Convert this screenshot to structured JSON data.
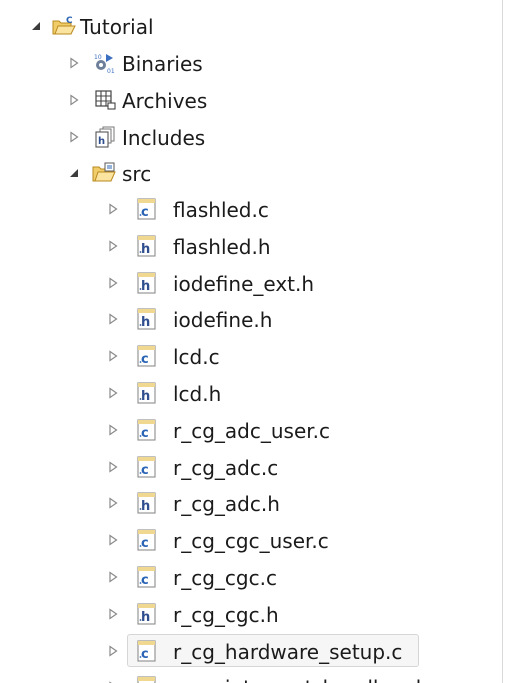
{
  "tree": {
    "project": {
      "label": "Tutorial",
      "expanded": true,
      "icon": "c-project-folder-icon"
    },
    "binaries": {
      "label": "Binaries",
      "icon": "binaries-icon"
    },
    "archives": {
      "label": "Archives",
      "icon": "archives-icon"
    },
    "includes": {
      "label": "Includes",
      "icon": "includes-icon"
    },
    "src": {
      "label": "src",
      "expanded": true,
      "icon": "source-folder-icon"
    },
    "files": [
      {
        "label": "flashled.c",
        "type": "c"
      },
      {
        "label": "flashled.h",
        "type": "h"
      },
      {
        "label": "iodefine_ext.h",
        "type": "h"
      },
      {
        "label": "iodefine.h",
        "type": "h"
      },
      {
        "label": "lcd.c",
        "type": "c"
      },
      {
        "label": "lcd.h",
        "type": "h"
      },
      {
        "label": "r_cg_adc_user.c",
        "type": "c"
      },
      {
        "label": "r_cg_adc.c",
        "type": "c"
      },
      {
        "label": "r_cg_adc.h",
        "type": "h"
      },
      {
        "label": "r_cg_cgc_user.c",
        "type": "c"
      },
      {
        "label": "r_cg_cgc.c",
        "type": "c"
      },
      {
        "label": "r_cg_cgc.h",
        "type": "h"
      },
      {
        "label": "r_cg_hardware_setup.c",
        "type": "c",
        "selected": true
      },
      {
        "label": "r_cg_interrupt_handlers.h",
        "type": "h"
      }
    ]
  },
  "colors": {
    "folder": "#e3b54a",
    "folder_dark": "#b98a1f",
    "c_letter": "#2a64b5",
    "h_letter": "#2f4f8f",
    "twisty": "#8a8a8a",
    "selection_border": "#d6d6d6"
  }
}
